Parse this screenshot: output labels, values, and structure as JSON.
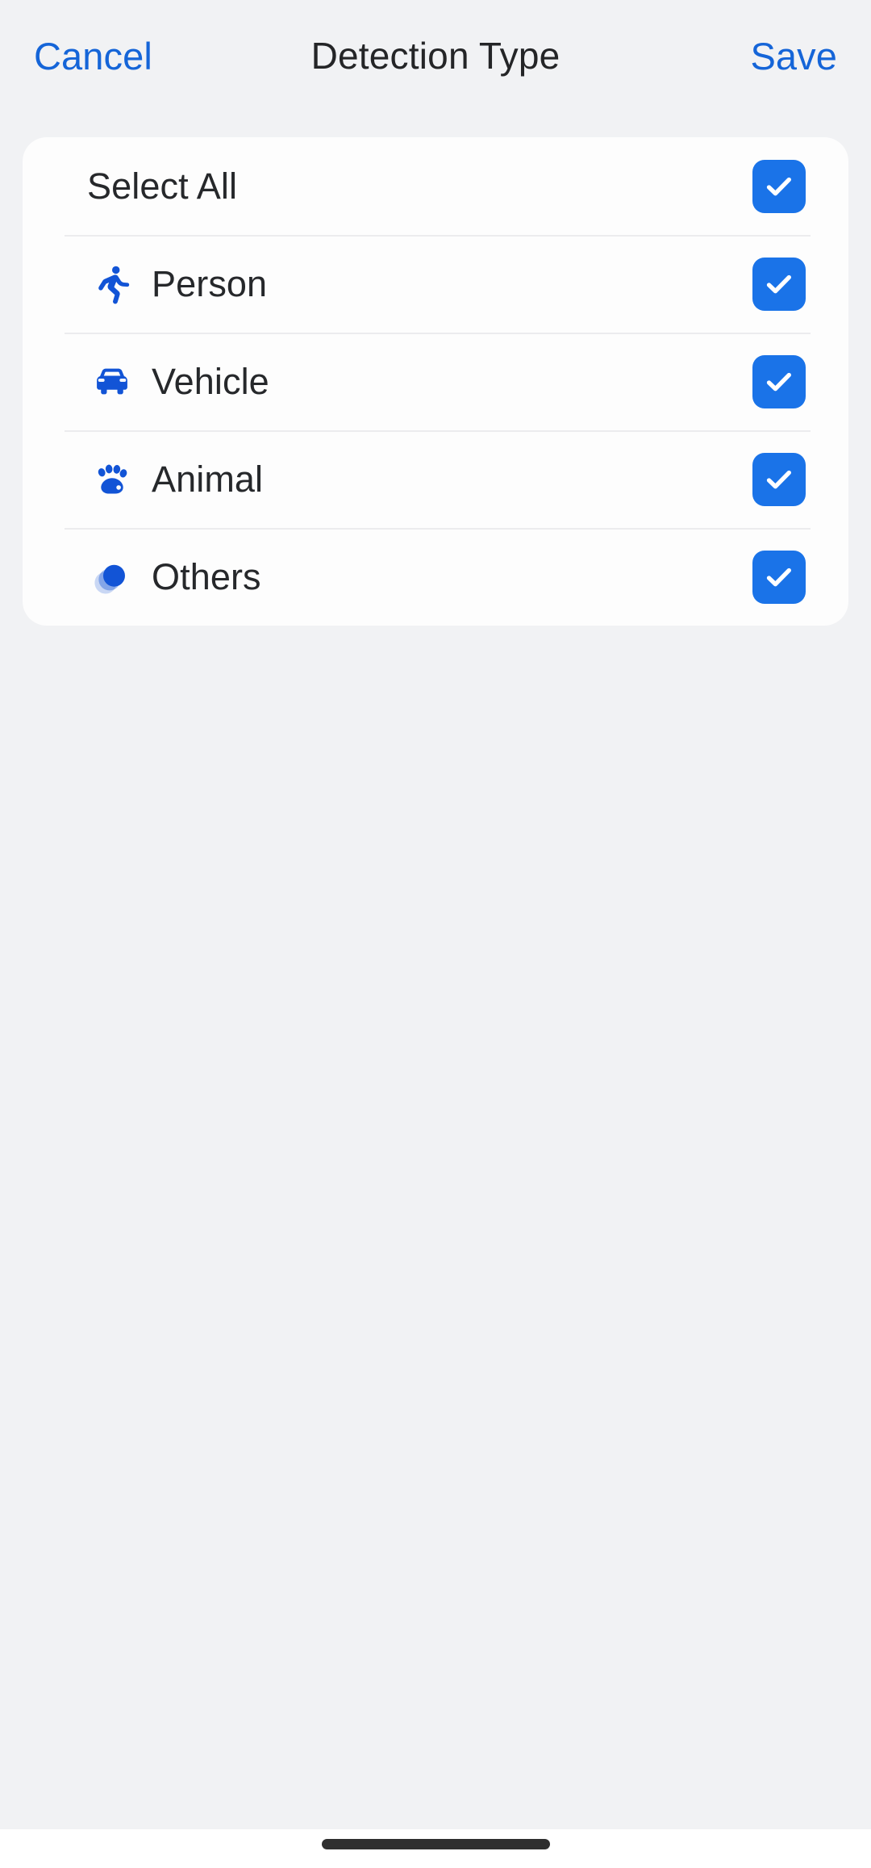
{
  "header": {
    "cancel_label": "Cancel",
    "title": "Detection Type",
    "save_label": "Save",
    "accent_color": "#1565d8",
    "title_color": "#242527"
  },
  "list": {
    "background_color": "#fdfdfd",
    "checkbox_color": "#1a73e8",
    "icon_color": "#1254d6",
    "rows": [
      {
        "label": "Select All",
        "icon": "none",
        "checked": true
      },
      {
        "label": "Person",
        "icon": "running-person-icon",
        "checked": true
      },
      {
        "label": "Vehicle",
        "icon": "car-icon",
        "checked": true
      },
      {
        "label": "Animal",
        "icon": "paw-icon",
        "checked": true
      },
      {
        "label": "Others",
        "icon": "circles-icon",
        "checked": true
      }
    ]
  },
  "system": {
    "home_indicator_color": "#2f2f2f",
    "page_background": "#f1f2f4"
  }
}
